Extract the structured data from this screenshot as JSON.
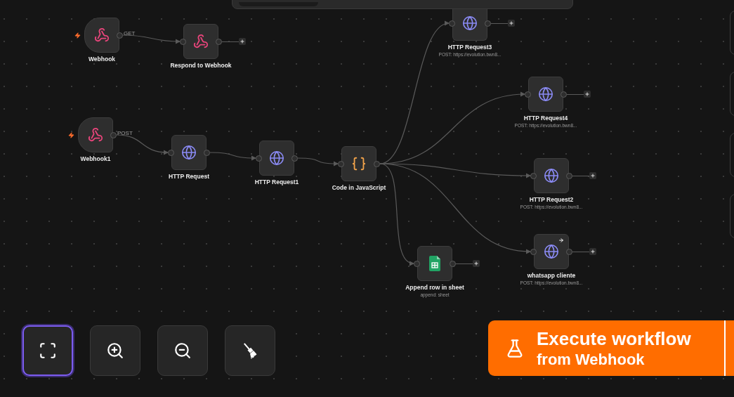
{
  "nodes": [
    {
      "name": "Webhook",
      "kind": "webhook_trigger",
      "output_label": "GET",
      "open_output": false,
      "arrow_badge": false
    },
    {
      "name": "Respond to Webhook",
      "kind": "webhook_response",
      "open_output": true,
      "arrow_badge": false
    },
    {
      "name": "Webhook1",
      "kind": "webhook_trigger",
      "output_label": "POST",
      "open_output": false,
      "arrow_badge": false
    },
    {
      "name": "HTTP Request",
      "kind": "http",
      "open_output": false,
      "arrow_badge": false
    },
    {
      "name": "HTTP Request1",
      "kind": "http",
      "open_output": false,
      "arrow_badge": false
    },
    {
      "name": "Code in JavaScript",
      "kind": "code",
      "open_output": false,
      "arrow_badge": false
    },
    {
      "name": "HTTP Request3",
      "subtitle": "POST: https://evolution.bwn8...",
      "kind": "http",
      "open_output": true,
      "arrow_badge": false
    },
    {
      "name": "HTTP Request4",
      "subtitle": "POST: https://evolution.bwn8...",
      "kind": "http",
      "open_output": true,
      "arrow_badge": false
    },
    {
      "name": "HTTP Request2",
      "subtitle": "POST: https://evolution.bwn8...",
      "kind": "http",
      "open_output": true,
      "arrow_badge": false
    },
    {
      "name": "Append row in sheet",
      "subtitle": "append: sheet",
      "kind": "sheet",
      "open_output": true,
      "arrow_badge": false
    },
    {
      "name": "whatsapp cliente",
      "subtitle": "POST: https://evolution.bwn8...",
      "kind": "http",
      "open_output": true,
      "arrow_badge": true
    }
  ],
  "canvas_controls": [
    {
      "kind": "fit",
      "selected": true
    },
    {
      "kind": "zoom_in",
      "selected": false
    },
    {
      "kind": "zoom_out",
      "selected": false
    },
    {
      "kind": "tidy",
      "selected": false
    }
  ],
  "execute_button": {
    "title": "Execute workflow",
    "subtitle": "from Webhook"
  }
}
